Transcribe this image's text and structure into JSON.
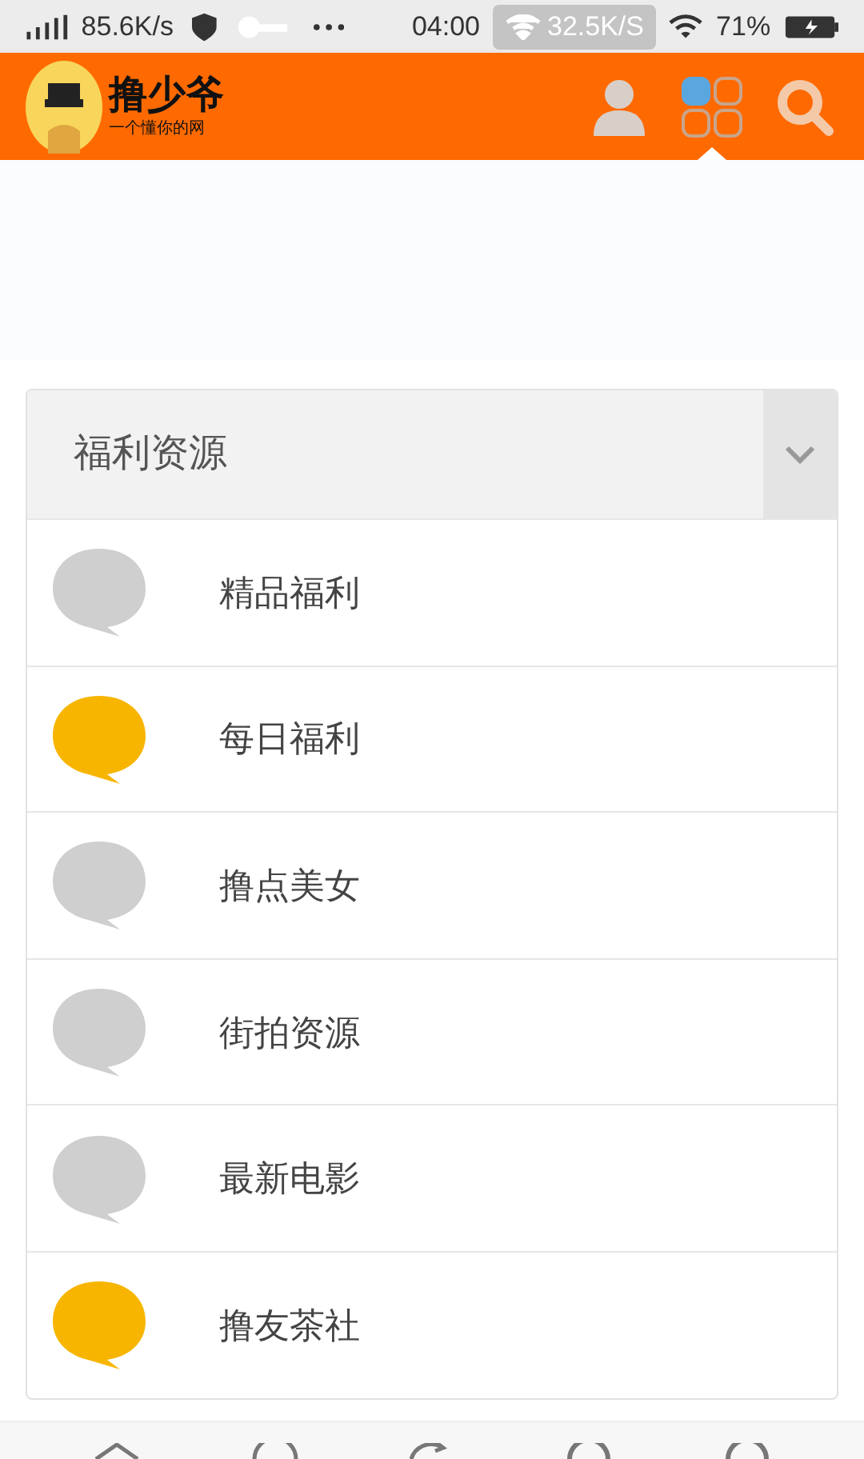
{
  "status_bar": {
    "speed": "85.6K/s",
    "time": "04:00",
    "bubble_speed": "32.5K/S",
    "battery": "71%"
  },
  "header": {
    "logo_title": "撸少爷",
    "logo_subtitle": "一个懂你的网",
    "nav": [
      {
        "kind": "user",
        "selected": false
      },
      {
        "kind": "apps",
        "selected": true
      },
      {
        "kind": "search",
        "selected": false
      }
    ]
  },
  "panel": {
    "title": "福利资源",
    "expanded": true,
    "items": [
      {
        "label": "精品福利",
        "color": "#cfcfcf"
      },
      {
        "label": "每日福利",
        "color": "#f7b500"
      },
      {
        "label": "撸点美女",
        "color": "#cfcfcf"
      },
      {
        "label": "街拍资源",
        "color": "#cfcfcf"
      },
      {
        "label": "最新电影",
        "color": "#cfcfcf"
      },
      {
        "label": "撸友茶社",
        "color": "#f7b500"
      }
    ]
  }
}
